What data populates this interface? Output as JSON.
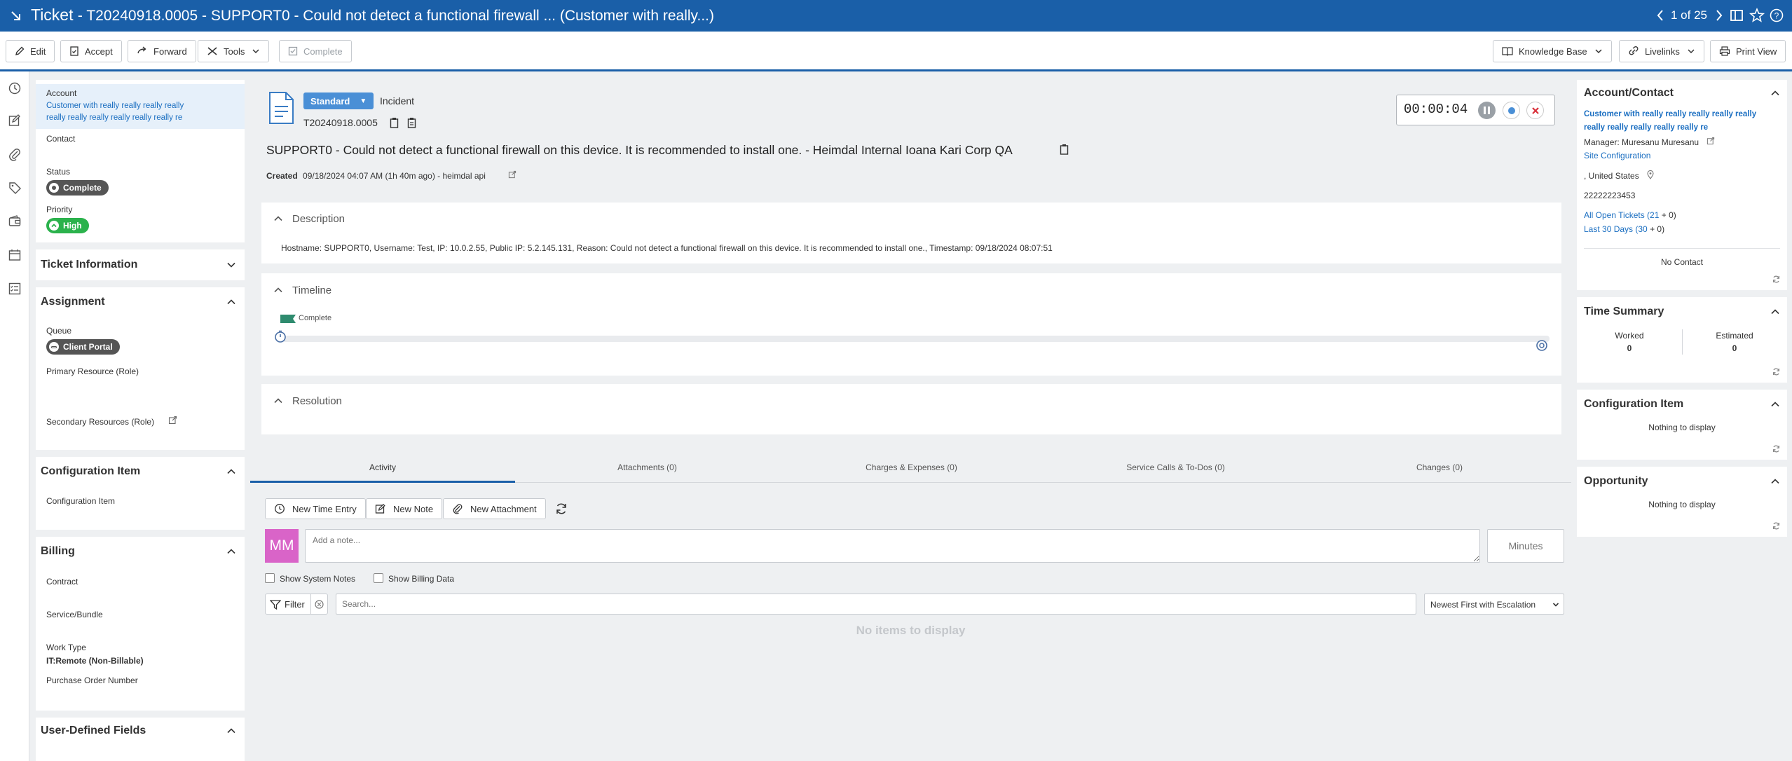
{
  "titlebar": {
    "title": "Ticket",
    "subtitle": "- T20240918.0005 - SUPPORT0 - Could not detect a functional firewall ... (Customer with really...)",
    "pager": "1 of 25"
  },
  "toolbar": {
    "edit": "Edit",
    "accept": "Accept",
    "forward": "Forward",
    "tools": "Tools",
    "complete": "Complete",
    "knowledge_base": "Knowledge Base",
    "livelinks": "Livelinks",
    "print_view": "Print View"
  },
  "left": {
    "account_label": "Account",
    "account_value_1": "Customer with really really really really",
    "account_value_2": "really really really really really really re",
    "contact_label": "Contact",
    "status_label": "Status",
    "status_value": "Complete",
    "priority_label": "Priority",
    "priority_value": "High",
    "ticket_info": "Ticket Information",
    "assignment": "Assignment",
    "queue_label": "Queue",
    "queue_value": "Client Portal",
    "primary_resource": "Primary Resource (Role)",
    "secondary_resources": "Secondary Resources (Role)",
    "config_item_header": "Configuration Item",
    "config_item_label": "Configuration Item",
    "billing": "Billing",
    "contract": "Contract",
    "service_bundle": "Service/Bundle",
    "work_type_label": "Work Type",
    "work_type_value": "IT:Remote (Non-Billable)",
    "po_number": "Purchase Order Number",
    "udf": "User-Defined Fields"
  },
  "ticket": {
    "category": "Standard",
    "type": "Incident",
    "number": "T20240918.0005",
    "title": "SUPPORT0 - Could not detect a functional firewall on this device. It is recommended to install one. - Heimdal Internal Ioana Kari Corp QA",
    "created_label": "Created",
    "created_value": "09/18/2024 04:07 AM (1h 40m ago) - heimdal api",
    "timer": "00:00:04"
  },
  "description": {
    "header": "Description",
    "text": "Hostname: SUPPORT0, Username: Test, IP: 10.0.2.55, Public IP: 5.2.145.131, Reason: Could not detect a functional firewall on this device. It is recommended to install one., Timestamp: 09/18/2024 08:07:51"
  },
  "timeline": {
    "header": "Timeline",
    "flag_label": "Complete"
  },
  "resolution": {
    "header": "Resolution"
  },
  "tabs": [
    "Activity",
    "Attachments (0)",
    "Charges & Expenses (0)",
    "Service Calls & To-Dos (0)",
    "Changes (0)"
  ],
  "activity": {
    "new_time_entry": "New Time Entry",
    "new_note": "New Note",
    "new_attachment": "New Attachment",
    "avatar": "MM",
    "note_placeholder": "Add a note...",
    "minutes_placeholder": "Minutes",
    "show_system_notes": "Show System Notes",
    "show_billing_data": "Show Billing Data",
    "filter": "Filter",
    "search_placeholder": "Search...",
    "sort_selected": "Newest First with Escalation",
    "empty": "No items to display"
  },
  "right": {
    "account_contact": "Account/Contact",
    "account_name_1": "Customer with really really really really really",
    "account_name_2": "really really really really really re",
    "manager": "Manager: Muresanu Muresanu",
    "site_config": "Site Configuration",
    "country": ",  United States",
    "phone": "22222223453",
    "open_tickets_label": "All Open Tickets",
    "open_tickets_count": "(21",
    "open_tickets_extra": "+ 0)",
    "last30_label": "Last 30 Days",
    "last30_count": "(30",
    "last30_extra": "+ 0)",
    "no_contact": "No Contact",
    "time_summary": "Time Summary",
    "worked_label": "Worked",
    "worked_value": "0",
    "estimated_label": "Estimated",
    "estimated_value": "0",
    "config_item": "Configuration Item",
    "config_nothing": "Nothing to display",
    "opportunity": "Opportunity",
    "opp_nothing": "Nothing to display"
  },
  "colors": {
    "brand": "#1a5fa8",
    "status_complete": "#555555",
    "priority_high": "#2bb24c",
    "link": "#1a6ec1",
    "avatar": "#d964c8"
  }
}
